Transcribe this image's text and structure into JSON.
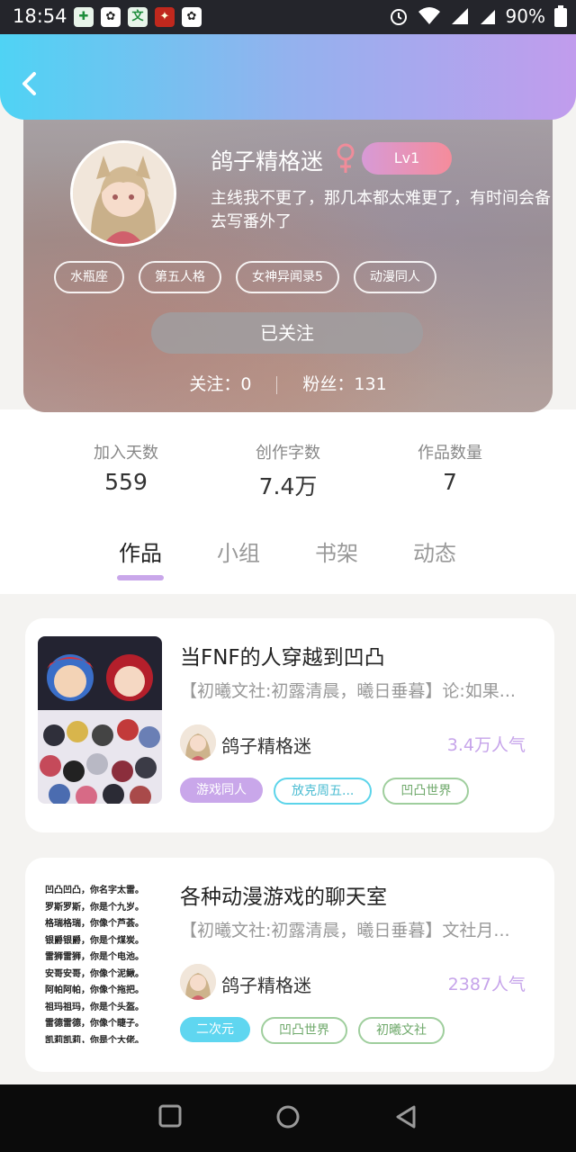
{
  "status_bar": {
    "time": "18:54",
    "battery": "90%",
    "app_icons": [
      "文"
    ]
  },
  "header": {
    "back_icon": "chevron-left-icon"
  },
  "profile": {
    "nickname": "鸽子精格迷",
    "gender": "female",
    "level": "Lv1",
    "bio": "主线我不更了，那几本都太难更了，有时间会备去写番外了",
    "tags": [
      "水瓶座",
      "第五人格",
      "女神异闻录5",
      "动漫同人"
    ],
    "follow_button": "已关注",
    "following_label": "关注：0",
    "fans_label": "粉丝：131"
  },
  "stats": [
    {
      "label": "加入天数",
      "value": "559"
    },
    {
      "label": "创作字数",
      "value": "7.4万"
    },
    {
      "label": "作品数量",
      "value": "7"
    }
  ],
  "tabs": [
    {
      "label": "作品",
      "active": true
    },
    {
      "label": "小组",
      "active": false
    },
    {
      "label": "书架",
      "active": false
    },
    {
      "label": "动态",
      "active": false
    }
  ],
  "works": [
    {
      "title": "当FNF的人穿越到凹凸",
      "desc": "【初曦文社:初露清晨，曦日垂暮】论:如果...",
      "author": "鸽子精格迷",
      "popularity": "3.4万人气",
      "tags": [
        "游戏同人",
        "放克周五...",
        "凹凸世界"
      ]
    },
    {
      "title": "各种动漫游戏的聊天室",
      "desc": "【初曦文社:初露清晨，曦日垂暮】文社月...",
      "author": "鸽子精格迷",
      "popularity": "2387人气",
      "tags": [
        "二次元",
        "凹凸世界",
        "初曦文社"
      ],
      "cover_lines": [
        "凹凸凹凸，你名字太雷。",
        "罗斯罗斯，你是个九岁。",
        "格瑞格瑞，你像个芦荟。",
        "银爵银爵，你是个煤炭。",
        "雷狮雷狮，你是个电池。",
        "安哥安哥，你像个泥鳅。",
        "阿帕阿帕，你像个拖把。",
        "祖玛祖玛，你是个头盔。",
        "雷德雷德，你像个睫子。",
        "凯莉凯莉，你是个大佬。"
      ]
    }
  ],
  "colors": {
    "accent": "#c9a7ea",
    "header_start": "#4fd3f4",
    "header_end": "#c19ced"
  }
}
